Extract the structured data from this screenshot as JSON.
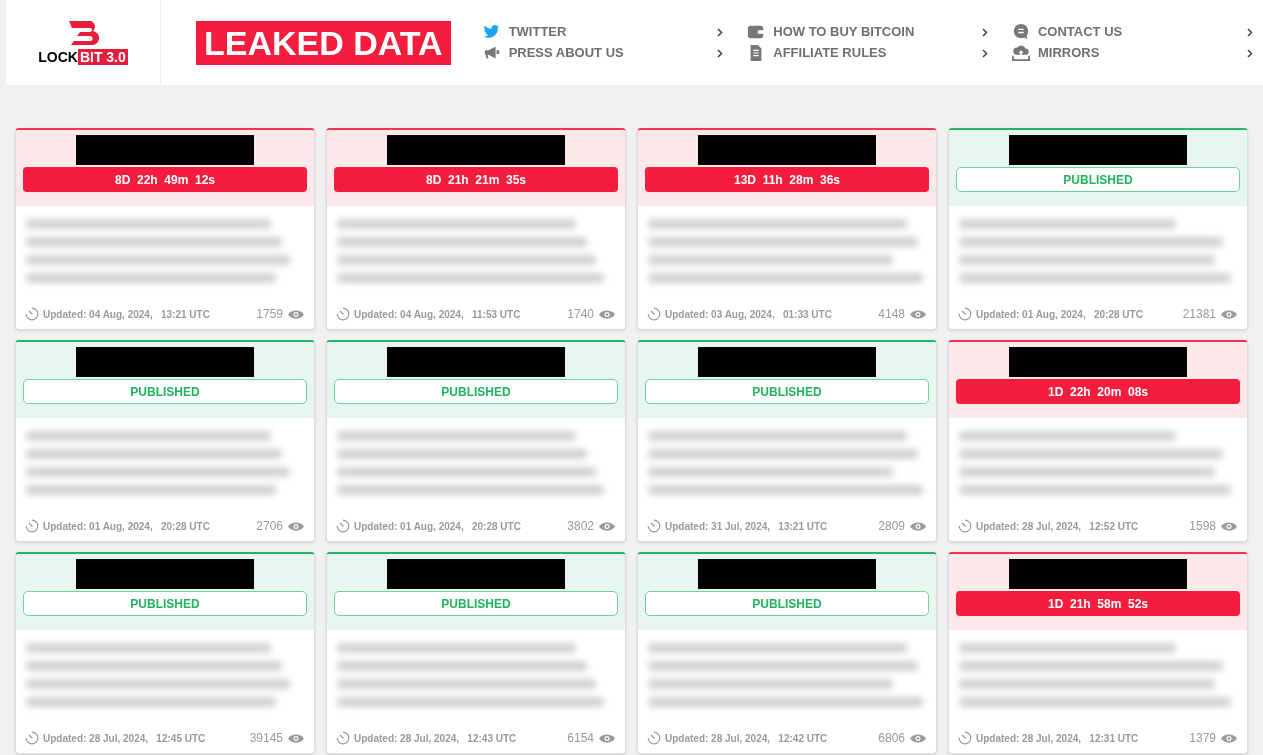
{
  "logo": {
    "word": "LOCK",
    "badge": "BIT 3.0"
  },
  "banner": "LEAKED DATA",
  "nav": [
    {
      "label": "TWITTER",
      "kind": "bird"
    },
    {
      "label": "PRESS ABOUT US",
      "kind": "megaphone"
    },
    {
      "label": "HOW TO BUY BITCOIN",
      "kind": "wallet"
    },
    {
      "label": "AFFILIATE RULES",
      "kind": "document"
    },
    {
      "label": "CONTACT US",
      "kind": "chat"
    },
    {
      "label": "MIRRORS",
      "kind": "cloud"
    }
  ],
  "posts": [
    {
      "kind": "countdown",
      "badge": "8D  22h  49m  12s",
      "updated": "Updated: 04 Aug, 2024,   13:21 UTC",
      "views": "1759"
    },
    {
      "kind": "countdown",
      "badge": "8D  21h  21m  35s",
      "updated": "Updated: 04 Aug, 2024,   11:53 UTC",
      "views": "1740"
    },
    {
      "kind": "countdown",
      "badge": "13D  11h  28m  36s",
      "updated": "Updated: 03 Aug, 2024,   01:33 UTC",
      "views": "4148"
    },
    {
      "kind": "published",
      "badge": "PUBLISHED",
      "updated": "Updated: 01 Aug, 2024,   20:28 UTC",
      "views": "21381"
    },
    {
      "kind": "published",
      "badge": "PUBLISHED",
      "updated": "Updated: 01 Aug, 2024,   20:28 UTC",
      "views": "2706"
    },
    {
      "kind": "published",
      "badge": "PUBLISHED",
      "updated": "Updated: 01 Aug, 2024,   20:28 UTC",
      "views": "3802"
    },
    {
      "kind": "published",
      "badge": "PUBLISHED",
      "updated": "Updated: 31 Jul, 2024,   13:21 UTC",
      "views": "2809"
    },
    {
      "kind": "countdown",
      "badge": "1D  22h  20m  08s",
      "updated": "Updated: 28 Jul, 2024,   12:52 UTC",
      "views": "1598"
    },
    {
      "kind": "published",
      "badge": "PUBLISHED",
      "updated": "Updated: 28 Jul, 2024,   12:45 UTC",
      "views": "39145"
    },
    {
      "kind": "published",
      "badge": "PUBLISHED",
      "updated": "Updated: 28 Jul, 2024,   12:43 UTC",
      "views": "6154"
    },
    {
      "kind": "published",
      "badge": "PUBLISHED",
      "updated": "Updated: 28 Jul, 2024,   12:42 UTC",
      "views": "6806"
    },
    {
      "kind": "countdown",
      "badge": "1D  21h  58m  52s",
      "updated": "Updated: 28 Jul, 2024,   12:31 UTC",
      "views": "1379"
    }
  ]
}
